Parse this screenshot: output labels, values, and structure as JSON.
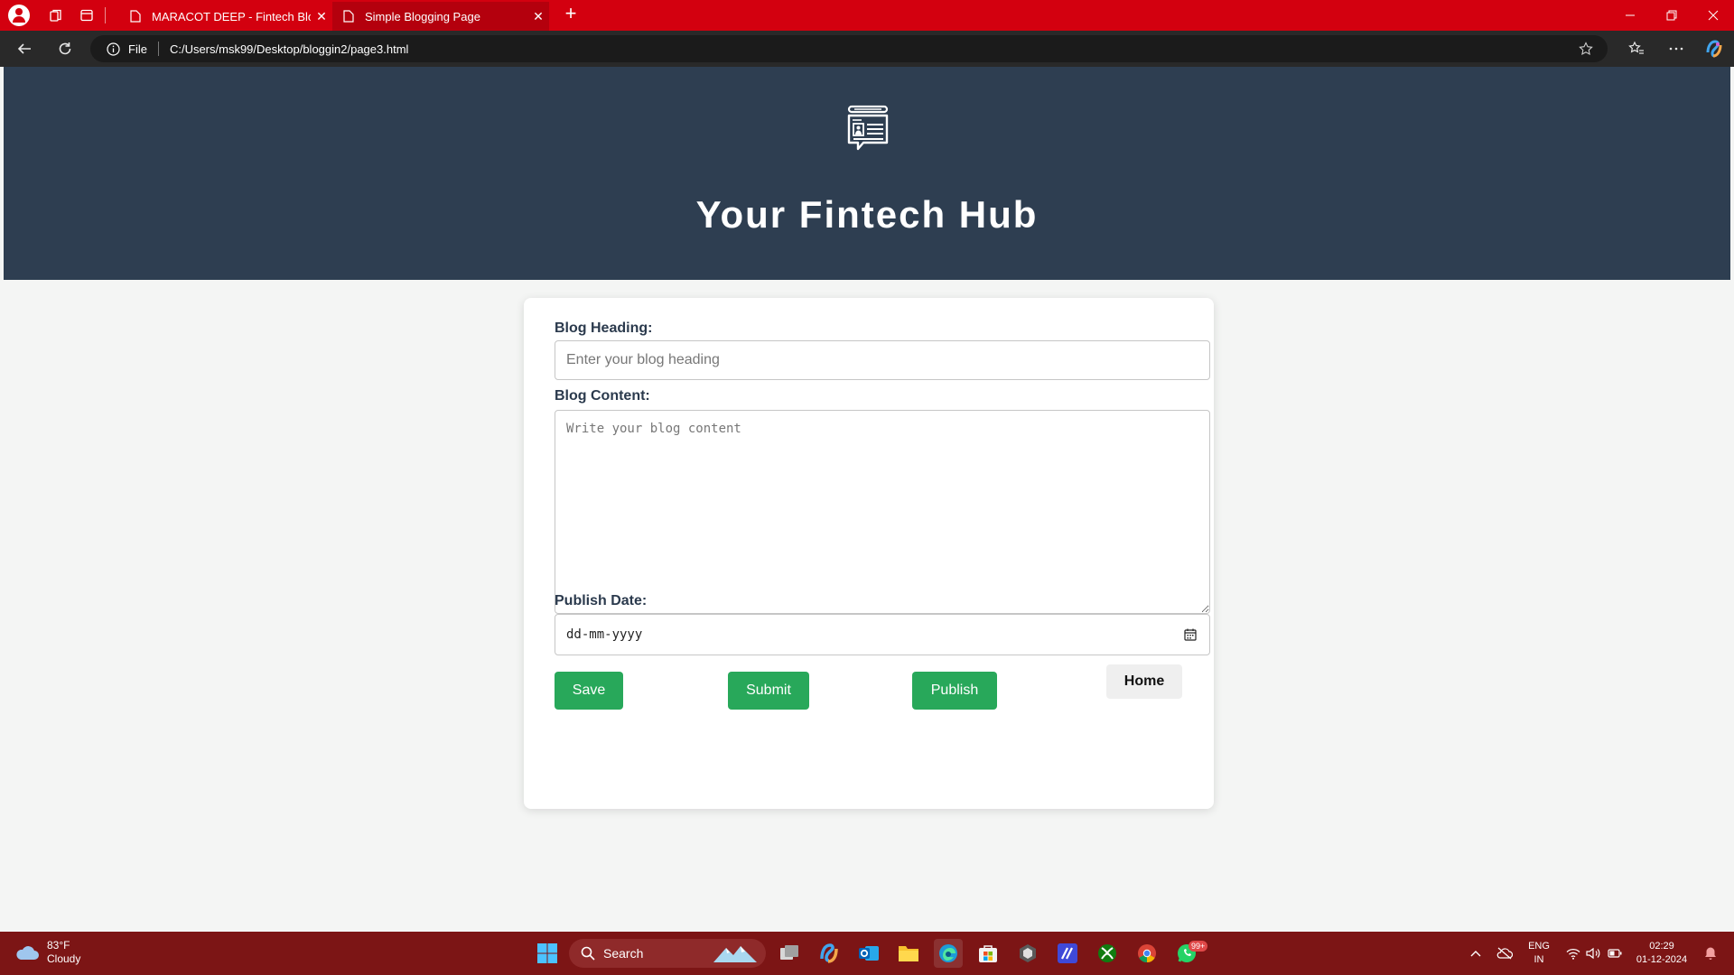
{
  "browser": {
    "tabs": [
      {
        "title": "MARACOT DEEP - Fintech Bloggin",
        "active": false
      },
      {
        "title": "Simple Blogging Page",
        "active": true
      }
    ],
    "address": {
      "scheme_label": "File",
      "url": "C:/Users/msk99/Desktop/bloggin2/page3.html"
    },
    "accent_color": "#d3000f"
  },
  "page": {
    "header": {
      "title": "Your Fintech Hub",
      "logo_icon": "blog-news-icon",
      "background_color": "#2e3e51"
    },
    "form": {
      "heading_label": "Blog Heading:",
      "heading_placeholder": "Enter your blog heading",
      "heading_value": "",
      "content_label": "Blog Content:",
      "content_placeholder": "Write your blog content",
      "content_value": "",
      "date_label": "Publish Date:",
      "date_placeholder": "dd-mm-yyyy",
      "buttons": {
        "save": "Save",
        "submit": "Submit",
        "publish": "Publish",
        "home": "Home"
      },
      "button_color": "#28a85a"
    }
  },
  "taskbar": {
    "weather": {
      "temp": "83°F",
      "condition": "Cloudy"
    },
    "search_label": "Search",
    "language": {
      "line1": "ENG",
      "line2": "IN"
    },
    "clock": {
      "time": "02:29",
      "date": "01-12-2024"
    },
    "whatsapp_badge": "99+"
  }
}
